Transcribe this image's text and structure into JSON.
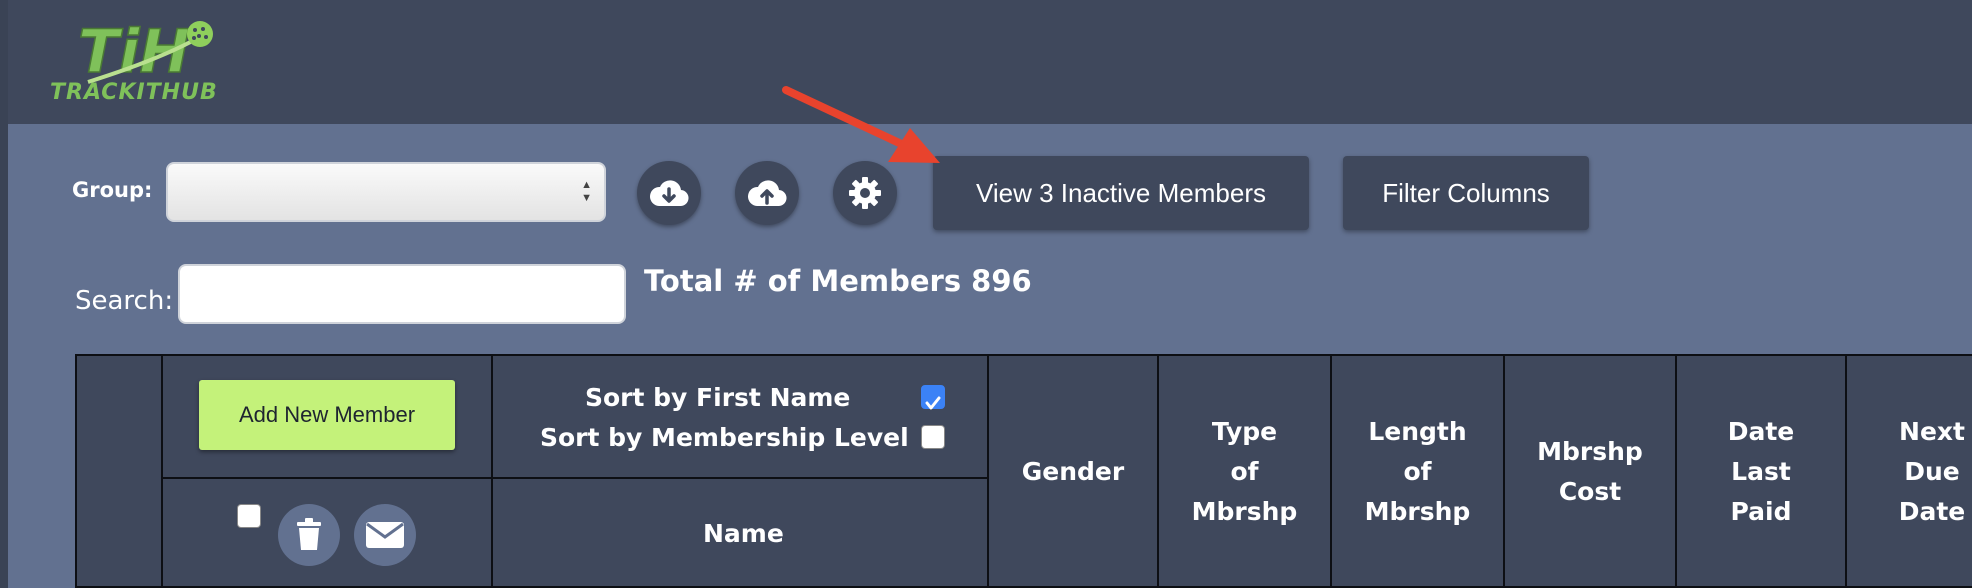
{
  "header": {
    "logo_text": "TRACKITHUB",
    "logo_mark": "TiH"
  },
  "toolbar": {
    "group_label": "Group:",
    "group_value": "",
    "download_icon": "cloud-download-icon",
    "upload_icon": "cloud-upload-icon",
    "settings_icon": "gear-icon",
    "inactive_members_label": "View 3 Inactive Members",
    "filter_columns_label": "Filter Columns"
  },
  "search": {
    "label": "Search:",
    "value": "",
    "placeholder": ""
  },
  "summary": {
    "total_text": "Total # of Members 896"
  },
  "table": {
    "add_member_label": "Add New Member",
    "sort_first_name_label": "Sort by First Name",
    "sort_first_name_checked": true,
    "sort_membership_label": "Sort by Membership Level",
    "sort_membership_checked": false,
    "select_all_checked": false,
    "delete_icon": "trash-icon",
    "email_icon": "envelope-icon",
    "columns": {
      "name": "Name",
      "gender": "Gender",
      "type": [
        "Type",
        "of",
        "Mbrshp"
      ],
      "length": [
        "Length",
        "of",
        "Mbrshp"
      ],
      "cost": [
        "Mbrshp",
        "Cost"
      ],
      "last_paid": [
        "Date",
        "Last",
        "Paid"
      ],
      "next_due": [
        "Next",
        "Due",
        "Date"
      ]
    }
  },
  "colors": {
    "page_bg": "#627190",
    "header_bg": "#3f485c",
    "accent_green": "#c4f27a",
    "annotation_red": "#e8432d"
  }
}
